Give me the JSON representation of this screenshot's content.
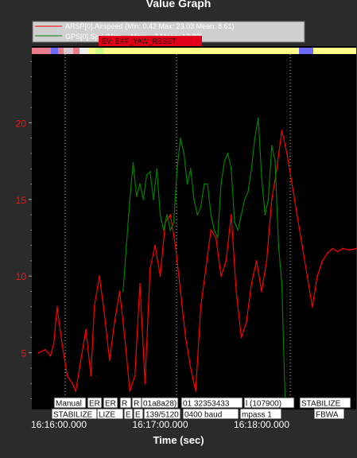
{
  "title": "Value Graph",
  "chart_data": {
    "type": "line",
    "title": "Value Graph",
    "xlabel": "Time (sec)",
    "ylabel": "",
    "x_ticks": [
      "16:16:00.000",
      "16:17:00.000",
      "16:18:00.000"
    ],
    "x_tick_seconds": [
      0,
      60,
      120
    ],
    "xlim_seconds": [
      -16,
      176
    ],
    "ylim": [
      1.3,
      25
    ],
    "y_ticks": [
      5,
      10,
      15,
      20
    ],
    "grid": false,
    "legend_position": "top-left",
    "series": [
      {
        "name": "ARSP[0].Airspeed",
        "legend_text": "ARSP[0].Airspeed  (Min: 0.42 Max: 23.03 Mean: 8.61)",
        "color": "#ff0000",
        "x": [
          -12,
          -8,
          -5,
          -3,
          -1,
          2,
          5,
          8,
          10,
          13,
          16,
          19,
          21,
          24,
          27,
          30,
          33,
          36,
          39,
          42,
          45,
          48,
          51,
          54,
          57,
          60,
          63,
          66,
          69,
          72,
          75,
          78,
          81,
          84,
          87,
          90,
          93,
          96,
          99,
          102,
          105,
          108,
          111,
          114,
          117,
          120,
          123,
          126,
          129,
          132,
          135,
          138,
          141,
          144,
          147,
          150,
          153,
          156,
          159,
          162,
          165,
          168,
          172,
          176
        ],
        "y": [
          5.0,
          5.2,
          4.8,
          5.6,
          8.0,
          5.5,
          3.5,
          3.0,
          2.5,
          4.5,
          6.5,
          3.5,
          8.0,
          10.0,
          7.5,
          4.5,
          7.0,
          9.0,
          6.0,
          2.5,
          3.5,
          9.5,
          3.0,
          10.5,
          12.0,
          10.0,
          13.5,
          14.0,
          12.0,
          9.0,
          6.0,
          4.0,
          2.5,
          8.0,
          10.5,
          13.0,
          12.5,
          10.0,
          11.0,
          14.0,
          9.0,
          6.0,
          7.0,
          9.5,
          11.0,
          9.0,
          11.0,
          15.0,
          17.0,
          19.5,
          18.0,
          16.0,
          14.0,
          12.0,
          10.0,
          8.0,
          10.0,
          11.0,
          11.5,
          11.8,
          11.6,
          11.8,
          11.7,
          11.8
        ]
      },
      {
        "name": "GPS[0].Spd",
        "legend_text": "GPS[0].Spd  (Min: ... Max: ...2 Mean: 13.83)",
        "color": "#008000",
        "x": [
          38,
          40,
          42,
          44,
          46,
          48,
          50,
          52,
          54,
          56,
          58,
          60,
          62,
          64,
          66,
          68,
          70,
          72,
          74,
          76,
          78,
          80,
          82,
          84,
          86,
          88,
          90,
          92,
          94,
          96,
          98,
          100,
          102,
          104,
          106,
          108,
          110,
          112,
          114,
          116,
          118,
          120,
          122,
          124,
          126,
          128,
          130,
          132,
          134
        ],
        "y": [
          9.0,
          12.0,
          15.0,
          17.4,
          15.2,
          16.0,
          15.0,
          16.6,
          16.8,
          15.0,
          17.0,
          14.0,
          13.0,
          14.0,
          13.0,
          13.5,
          17.0,
          19.0,
          18.0,
          16.0,
          17.0,
          15.0,
          14.0,
          14.5,
          16.0,
          16.0,
          14.0,
          13.0,
          12.5,
          16.0,
          17.5,
          18.0,
          17.0,
          13.5,
          13.0,
          14.0,
          15.0,
          15.5,
          17.0,
          19.0,
          20.3,
          16.5,
          14.0,
          15.0,
          18.5,
          17.5,
          12.0,
          9.5,
          1.5
        ]
      }
    ],
    "event_marker": "EV: EKF_YAW_RESET",
    "mode_markers_top": [
      "Manual",
      "ER",
      "ER",
      "R",
      "R",
      "01a8a28)",
      "01 32353433",
      "l (107900)",
      "STABILIZE"
    ],
    "mode_markers_bottom": [
      "STABILIZE",
      "LIZE",
      "E",
      "E",
      "139/5120",
      "0400 baud",
      "mpass 1",
      "FBWA"
    ]
  }
}
